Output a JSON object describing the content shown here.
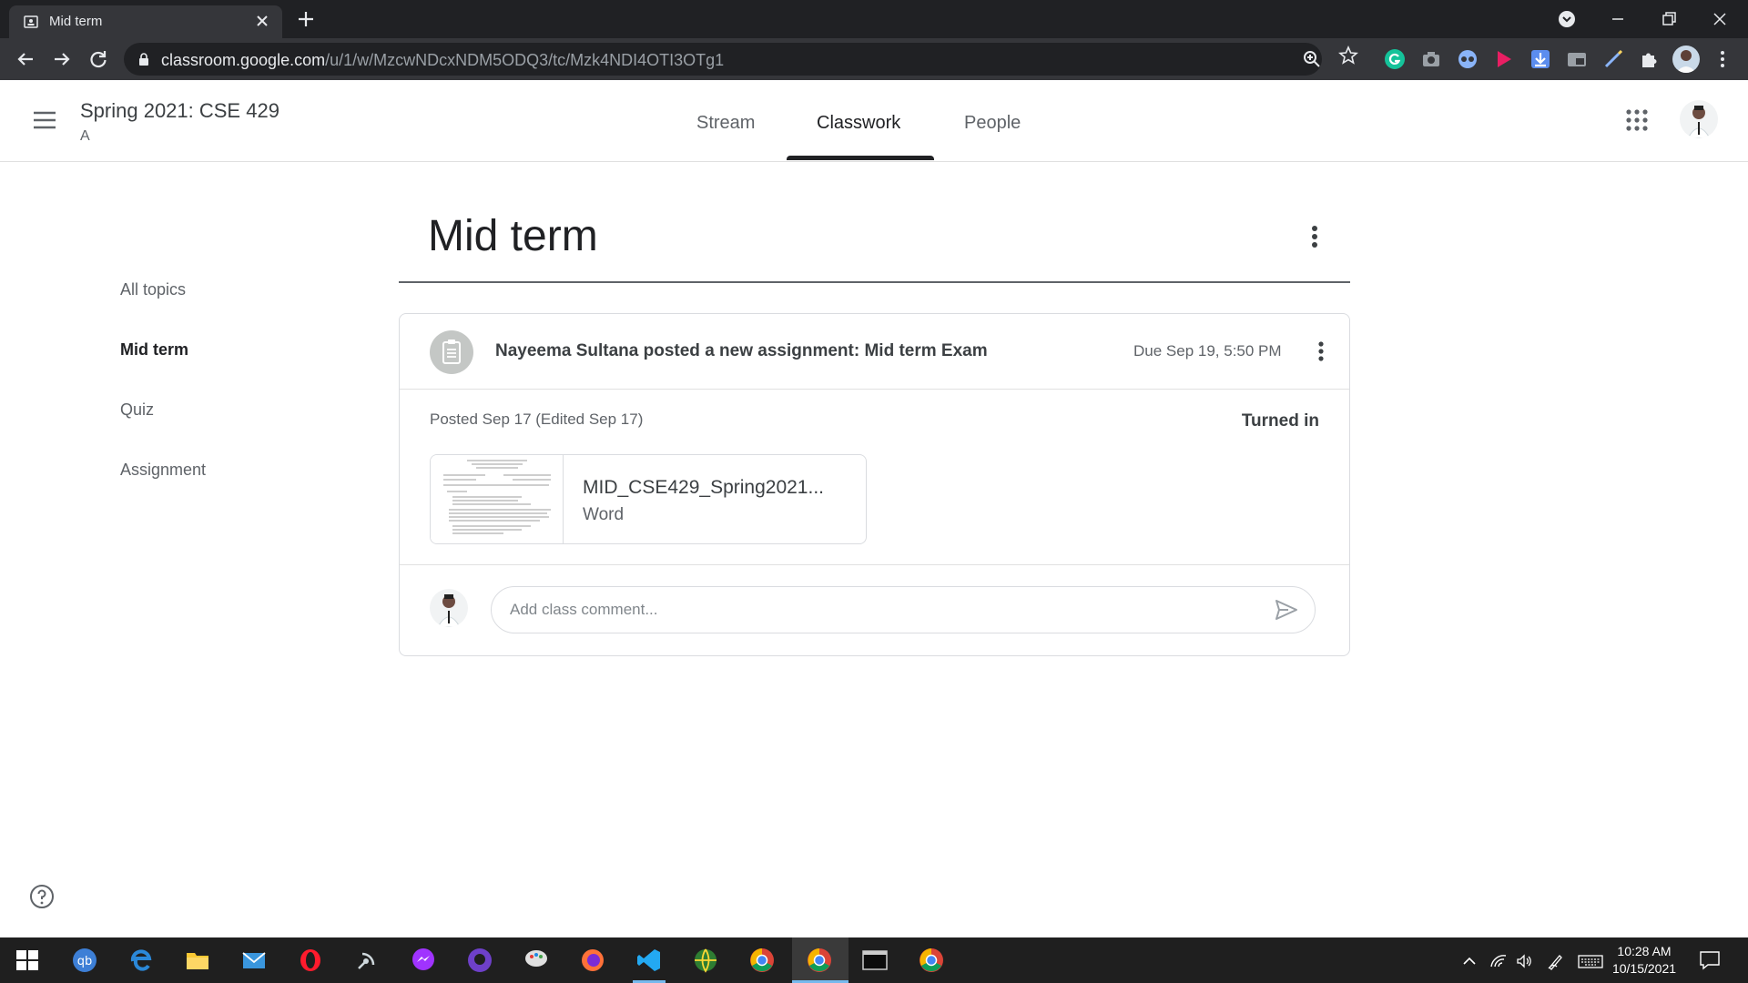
{
  "browser": {
    "tab_title": "Mid term",
    "url_host": "classroom.google.com",
    "url_path": "/u/1/w/MzcwNDcxNDM5ODQ3/tc/Mzk4NDI4OTI3OTg1"
  },
  "header": {
    "class_title": "Spring 2021: CSE 429",
    "class_section": "A",
    "tabs": [
      {
        "label": "Stream",
        "active": false
      },
      {
        "label": "Classwork",
        "active": true
      },
      {
        "label": "People",
        "active": false
      }
    ]
  },
  "topics": [
    {
      "label": "All topics",
      "active": false
    },
    {
      "label": "Mid term",
      "active": true
    },
    {
      "label": "Quiz",
      "active": false
    },
    {
      "label": "Assignment",
      "active": false
    }
  ],
  "main": {
    "topic_title": "Mid term",
    "assignment": {
      "title": "Nayeema Sultana posted a new assignment: Mid term Exam",
      "due": "Due Sep 19, 5:50 PM",
      "posted": "Posted Sep 17 (Edited Sep 17)",
      "status": "Turned in",
      "attachment": {
        "name": "MID_CSE429_Spring2021...",
        "type": "Word"
      },
      "comment_placeholder": "Add class comment..."
    }
  },
  "taskbar": {
    "time": "10:28 AM",
    "date": "10/15/2021"
  },
  "colors": {
    "chrome_dark": "#202124",
    "chrome_toolbar": "#35363a",
    "text_primary": "#202124",
    "text_secondary": "#5f6368",
    "divider": "#dadce0",
    "taskbar": "#1f1f1f"
  }
}
